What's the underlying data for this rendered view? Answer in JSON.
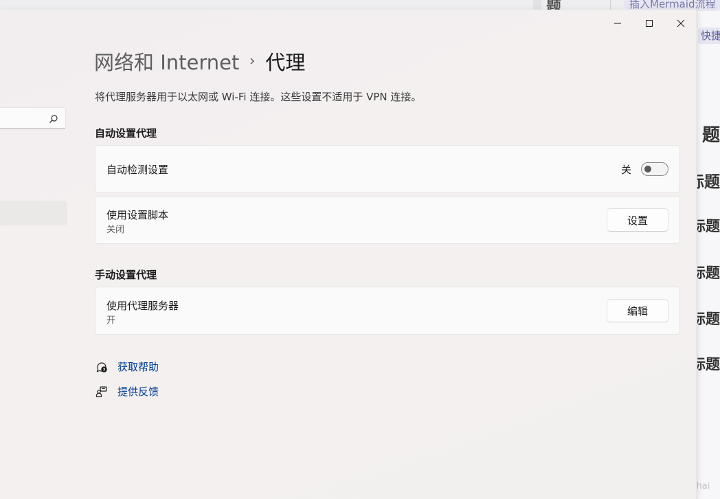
{
  "background_app": {
    "top_char": "题",
    "pill_text": "插入Mermaid流程",
    "pill2_text": "快捷",
    "heading_fragments": [
      "题",
      "标题",
      "标题",
      "标题",
      "标题",
      "级标题"
    ],
    "watermark": "CSDN @LinlyZhai"
  },
  "window": {
    "titlebar": {
      "minimize_icon": "minimize-icon",
      "maximize_icon": "maximize-icon",
      "close_icon": "close-icon"
    },
    "sidebar": {
      "search_icon": "search-icon"
    },
    "breadcrumb": {
      "parent": "网络和 Internet",
      "separator_icon": "chevron-right-icon",
      "current": "代理"
    },
    "description": "将代理服务器用于以太网或 Wi-Fi 连接。这些设置不适用于 VPN 连接。",
    "auto_section": {
      "title": "自动设置代理",
      "detect": {
        "label": "自动检测设置",
        "toggle_state": "关"
      },
      "script": {
        "label": "使用设置脚本",
        "status": "关闭",
        "button": "设置"
      }
    },
    "manual_section": {
      "title": "手动设置代理",
      "proxy": {
        "label": "使用代理服务器",
        "status": "开",
        "button": "编辑"
      }
    },
    "links": {
      "help": "获取帮助",
      "feedback": "提供反馈"
    }
  },
  "colors": {
    "link": "#003e92",
    "text": "#1b1b1b",
    "card_bg": "#fbfafa"
  }
}
